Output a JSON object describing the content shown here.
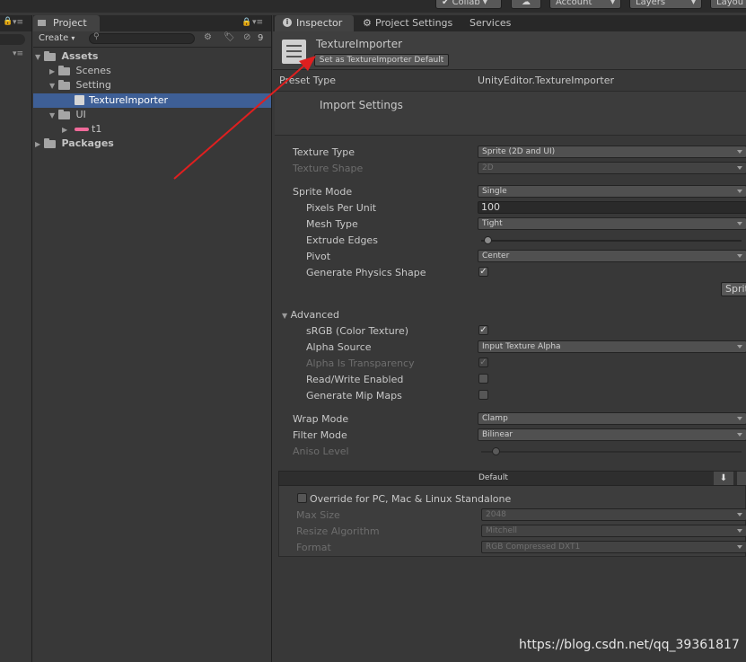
{
  "toolbar": {
    "collab": "Collab",
    "account": "Account",
    "layers": "Layers",
    "layout": "Layou"
  },
  "project": {
    "tab": "Project",
    "create": "Create",
    "hidden_count": "9",
    "tree": {
      "assets": "Assets",
      "scenes": "Scenes",
      "setting": "Setting",
      "texture_importer": "TextureImporter",
      "ui": "UI",
      "t1": "t1",
      "packages": "Packages"
    }
  },
  "tabs": {
    "inspector": "Inspector",
    "project_settings": "Project Settings",
    "services": "Services"
  },
  "inspector": {
    "title": "TextureImporter",
    "set_default": "Set as TextureImporter Default",
    "preset_type_label": "Preset Type",
    "preset_type_value": "UnityEditor.TextureImporter",
    "import_settings": "Import Settings",
    "texture_type": {
      "label": "Texture Type",
      "value": "Sprite (2D and UI)"
    },
    "texture_shape": {
      "label": "Texture Shape",
      "value": "2D"
    },
    "sprite_mode": {
      "label": "Sprite Mode",
      "value": "Single"
    },
    "pixels_per_unit": {
      "label": "Pixels Per Unit",
      "value": "100"
    },
    "mesh_type": {
      "label": "Mesh Type",
      "value": "Tight"
    },
    "extrude_edges": {
      "label": "Extrude Edges"
    },
    "pivot": {
      "label": "Pivot",
      "value": "Center"
    },
    "generate_physics_shape": {
      "label": "Generate Physics Shape",
      "checked": true
    },
    "sprite_editor_button": "Sprit",
    "advanced": "Advanced",
    "srgb": {
      "label": "sRGB (Color Texture)",
      "checked": true
    },
    "alpha_source": {
      "label": "Alpha Source",
      "value": "Input Texture Alpha"
    },
    "alpha_transparency": {
      "label": "Alpha Is Transparency",
      "checked": true
    },
    "read_write": {
      "label": "Read/Write Enabled",
      "checked": false
    },
    "mip_maps": {
      "label": "Generate Mip Maps",
      "checked": false
    },
    "wrap_mode": {
      "label": "Wrap Mode",
      "value": "Clamp"
    },
    "filter_mode": {
      "label": "Filter Mode",
      "value": "Bilinear"
    },
    "aniso_level": {
      "label": "Aniso Level"
    },
    "platform_default": "Default",
    "override": {
      "label": "Override for PC, Mac & Linux Standalone",
      "checked": false
    },
    "max_size": {
      "label": "Max Size",
      "value": "2048"
    },
    "resize_algorithm": {
      "label": "Resize Algorithm",
      "value": "Mitchell"
    },
    "format": {
      "label": "Format",
      "value": "RGB Compressed DXT1"
    }
  },
  "watermark": "https://blog.csdn.net/qq_39361817",
  "colors": {
    "selection": "#3e5f96",
    "annotation_arrow": "#e01f1f"
  }
}
